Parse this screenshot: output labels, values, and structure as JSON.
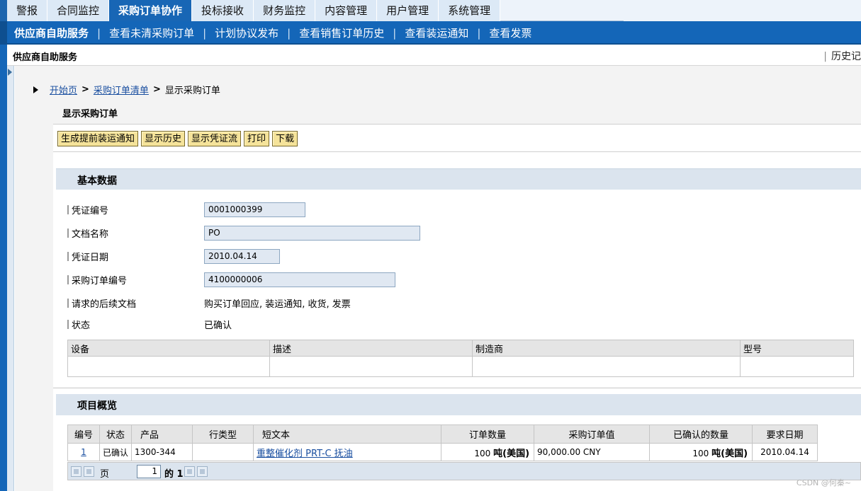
{
  "top_nav": {
    "tabs": [
      {
        "label": "警报"
      },
      {
        "label": "合同监控"
      },
      {
        "label": "采购订单协作",
        "active": true
      },
      {
        "label": "投标接收"
      },
      {
        "label": "财务监控"
      },
      {
        "label": "内容管理"
      },
      {
        "label": "用户管理"
      },
      {
        "label": "系统管理"
      }
    ]
  },
  "sub_nav": {
    "items": [
      {
        "label": "供应商自助服务",
        "bold": true
      },
      {
        "label": "查看未清采购订单"
      },
      {
        "label": "计划协议发布"
      },
      {
        "label": "查看销售订单历史"
      },
      {
        "label": "查看装运通知"
      },
      {
        "label": "查看发票"
      }
    ],
    "separator": "|"
  },
  "page_header": {
    "title": "供应商自助服务",
    "history_label": "历史记"
  },
  "breadcrumb": {
    "home": "开始页",
    "list": "采购订单清单",
    "current": "显示采购订单",
    "arrow": ">"
  },
  "document_title": "显示采购订单",
  "toolbar": {
    "buttons": [
      "生成提前装运通知",
      "显示历史",
      "显示凭证流",
      "打印",
      "下载"
    ]
  },
  "basic_data": {
    "title": "基本数据",
    "fields": {
      "doc_number_label": "凭证编号",
      "doc_number": "0001000399",
      "doc_name_label": "文档名称",
      "doc_name": "PO",
      "doc_date_label": "凭证日期",
      "doc_date": "2010.04.14",
      "po_number_label": "采购订单编号",
      "po_number": "4100000006",
      "followup_label": "请求的后续文档",
      "followup": "购买订单回应, 装运通知, 收货, 发票",
      "status_label": "状态",
      "status": "已确认"
    },
    "equipment_columns": [
      "设备",
      "描述",
      "制造商",
      "型号"
    ]
  },
  "items_overview": {
    "title": "项目概览",
    "columns": [
      "编号",
      "状态",
      "产品",
      "行类型",
      "短文本",
      "订单数量",
      "采购订单值",
      "已确认的数量",
      "要求日期"
    ],
    "rows": [
      {
        "no": "1",
        "status": "已确认",
        "product": "1300-344",
        "item_type": "",
        "short_text": "重整催化剂 PRT-C 抚油",
        "order_qty_num": "100",
        "order_qty_unit": "吨(美国)",
        "po_value": "90,000.00 CNY",
        "confirmed_qty_num": "100",
        "confirmed_qty_unit": "吨(美国)",
        "required_date": "2010.04.14"
      }
    ],
    "pager": {
      "page_label": "页",
      "page": "1",
      "of_label": "的",
      "total": "1"
    }
  },
  "watermark": "CSDN @何秦~"
}
